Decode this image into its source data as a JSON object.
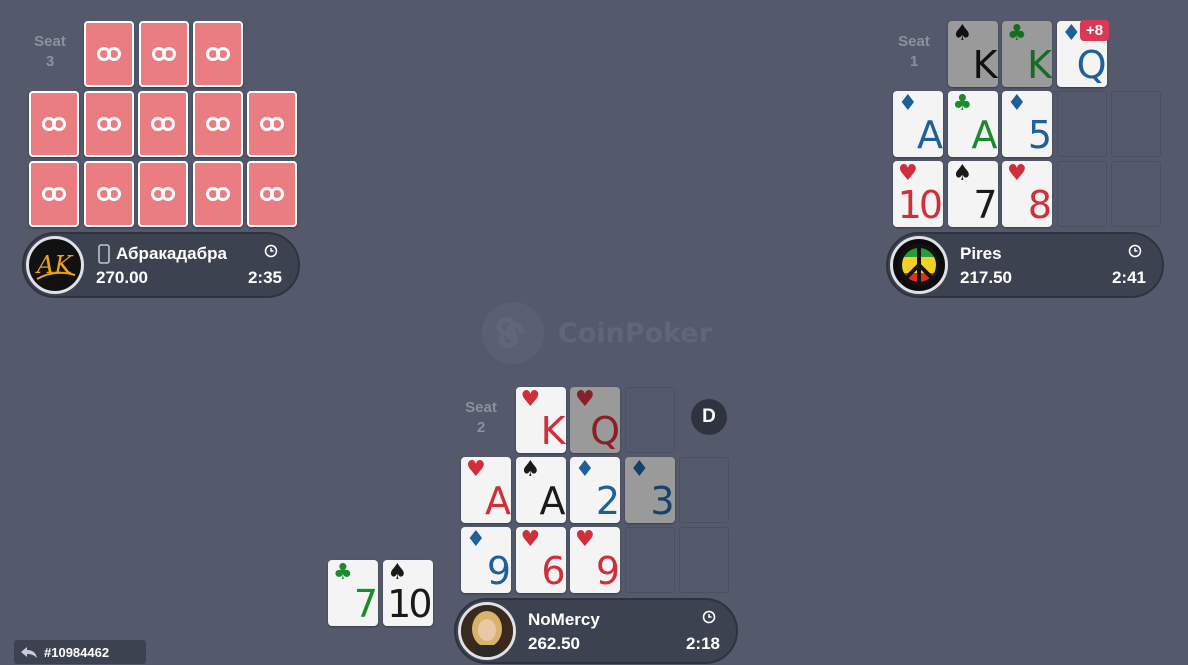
{
  "brand": {
    "name": "CoinPoker"
  },
  "hand": {
    "id": "#10984462"
  },
  "dealer_button": {
    "label": "D"
  },
  "seats": {
    "seat3": {
      "label_word": "Seat",
      "label_number": "3",
      "player": {
        "name": "Абракадабра",
        "stack": "270.00",
        "time": "2:35",
        "device_icon": "mobile-device-icon"
      }
    },
    "seat1": {
      "label_word": "Seat",
      "label_number": "1",
      "badge": "+8",
      "player": {
        "name": "Pires",
        "stack": "217.50",
        "time": "2:41"
      }
    },
    "seat2": {
      "label_word": "Seat",
      "label_number": "2",
      "player": {
        "name": "NoMercy",
        "stack": "262.50",
        "time": "2:18"
      }
    }
  },
  "cards": {
    "seat1_top": [
      {
        "rank": "K",
        "suit": "♠",
        "color": "black",
        "dim": true
      },
      {
        "rank": "K",
        "suit": "♣",
        "color": "green",
        "dim": true
      },
      {
        "rank": "Q",
        "suit": "♦",
        "color": "blue",
        "dim": false
      }
    ],
    "seat1_mid": [
      {
        "rank": "A",
        "suit": "♦",
        "color": "blue"
      },
      {
        "rank": "A",
        "suit": "♣",
        "color": "green"
      },
      {
        "rank": "5",
        "suit": "♦",
        "color": "blue"
      }
    ],
    "seat1_bot": [
      {
        "rank": "10",
        "suit": "♥",
        "color": "red"
      },
      {
        "rank": "7",
        "suit": "♠",
        "color": "black"
      },
      {
        "rank": "8",
        "suit": "♥",
        "color": "red"
      }
    ],
    "seat2_top": [
      {
        "rank": "K",
        "suit": "♥",
        "color": "red",
        "dim": false
      },
      {
        "rank": "Q",
        "suit": "♥",
        "color": "red",
        "dim": true
      }
    ],
    "seat2_mid": [
      {
        "rank": "A",
        "suit": "♥",
        "color": "red"
      },
      {
        "rank": "A",
        "suit": "♠",
        "color": "black"
      },
      {
        "rank": "2",
        "suit": "♦",
        "color": "blue"
      },
      {
        "rank": "3",
        "suit": "♦",
        "color": "blue",
        "dim": true
      }
    ],
    "seat2_bot": [
      {
        "rank": "9",
        "suit": "♦",
        "color": "blue"
      },
      {
        "rank": "6",
        "suit": "♥",
        "color": "red"
      },
      {
        "rank": "9",
        "suit": "♥",
        "color": "red"
      }
    ],
    "discards": [
      {
        "rank": "7",
        "suit": "♣",
        "color": "green"
      },
      {
        "rank": "10",
        "suit": "♠",
        "color": "black"
      }
    ]
  },
  "colors": {
    "table": "#545a6b",
    "card_back": "#e97d82",
    "badge": "#d83a55"
  }
}
